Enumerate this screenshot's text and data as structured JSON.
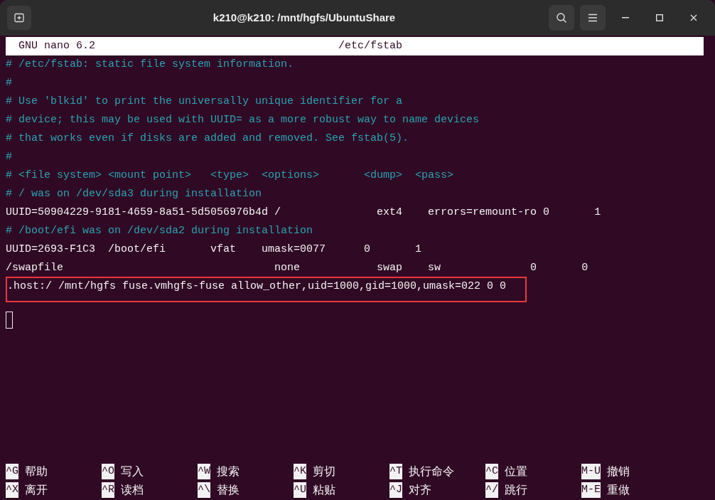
{
  "window": {
    "title": "k210@k210: /mnt/hgfs/UbuntuShare"
  },
  "nano_header": {
    "version": "GNU nano 6.2",
    "file": "/etc/fstab"
  },
  "lines": [
    {
      "kind": "comment",
      "text": "# /etc/fstab: static file system information."
    },
    {
      "kind": "comment",
      "text": "#"
    },
    {
      "kind": "comment",
      "text": "# Use 'blkid' to print the universally unique identifier for a"
    },
    {
      "kind": "comment",
      "text": "# device; this may be used with UUID= as a more robust way to name devices"
    },
    {
      "kind": "comment",
      "text": "# that works even if disks are added and removed. See fstab(5)."
    },
    {
      "kind": "comment",
      "text": "#"
    },
    {
      "kind": "comment",
      "text": "# <file system> <mount point>   <type>  <options>       <dump>  <pass>"
    },
    {
      "kind": "comment",
      "text": "# / was on /dev/sda3 during installation"
    },
    {
      "kind": "text",
      "text": "UUID=50904229-9181-4659-8a51-5d5056976b4d /               ext4    errors=remount-ro 0       1"
    },
    {
      "kind": "comment",
      "text": "# /boot/efi was on /dev/sda2 during installation"
    },
    {
      "kind": "text",
      "text": "UUID=2693-F1C3  /boot/efi       vfat    umask=0077      0       1"
    },
    {
      "kind": "text",
      "text": "/swapfile                                 none            swap    sw              0       0"
    },
    {
      "kind": "text",
      "text": ".host:/ /mnt/hgfs fuse.vmhgfs-fuse allow_other,uid=1000,gid=1000,umask=022 0 0",
      "boxed": true
    },
    {
      "kind": "cursor"
    }
  ],
  "shortcuts": [
    [
      {
        "key": "^G",
        "label": "帮助"
      },
      {
        "key": "^O",
        "label": "写入"
      },
      {
        "key": "^W",
        "label": "搜索"
      },
      {
        "key": "^K",
        "label": "剪切"
      },
      {
        "key": "^T",
        "label": "执行命令"
      },
      {
        "key": "^C",
        "label": "位置"
      },
      {
        "key": "M-U",
        "label": "撤销"
      }
    ],
    [
      {
        "key": "^X",
        "label": "离开"
      },
      {
        "key": "^R",
        "label": "读档"
      },
      {
        "key": "^\\",
        "label": "替换"
      },
      {
        "key": "^U",
        "label": "粘贴"
      },
      {
        "key": "^J",
        "label": "对齐"
      },
      {
        "key": "^/",
        "label": "跳行"
      },
      {
        "key": "M-E",
        "label": "重做"
      }
    ]
  ]
}
